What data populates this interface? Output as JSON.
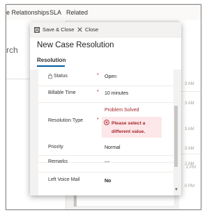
{
  "background": {
    "tabs": [
      "e Relationships",
      "SLA",
      "Related"
    ],
    "search_text": "rch",
    "timestamps": [
      "3 AM",
      "3 AM",
      "3 AM",
      "3 AM",
      "2 AM",
      "2 PM",
      "0 PM"
    ]
  },
  "dialog": {
    "commands": {
      "save_close": "Save & Close",
      "close": "Close"
    },
    "title": "New Case Resolution",
    "tab_label": "Resolution",
    "fields": [
      {
        "label": "Status",
        "required": "*",
        "value": "Open"
      },
      {
        "label": "Billable Time",
        "required": "*",
        "value": "10 minutes"
      },
      {
        "label": "Resolution Type",
        "required": "*",
        "value": "Problem Solved",
        "error": "Please select a different value."
      },
      {
        "label": "Priority",
        "value": "Normal"
      },
      {
        "label": "Remarks",
        "value": "---"
      },
      {
        "label": "Left Voice Mail",
        "value": "No"
      }
    ]
  },
  "colors": {
    "error_red": "#a4262c",
    "error_bg": "#fde7e9",
    "accent": "#005a9e"
  }
}
